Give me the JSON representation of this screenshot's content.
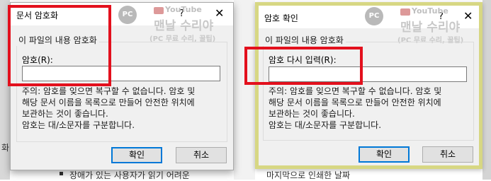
{
  "background": {
    "left_char": "화",
    "bottom_left_text": "장애가 있는 사용자가 읽기 어려운",
    "bottom_right_text": "마지막으로 인쇄한 날짜"
  },
  "watermark": {
    "logo_text": "PC",
    "youtube_label": "YouTube",
    "channel_name": "맨날 수리야",
    "channel_sub": "(PC 무료 수리, 꿀팁)"
  },
  "dialog_encrypt": {
    "title": "문서 암호화",
    "help": "?",
    "close": "✕",
    "group_label": "이 파일의 내용 암호화",
    "password_label": "암호(R):",
    "password_value": "",
    "note_lines": [
      "주의: 암호를 잊으면 복구할 수 없습니다. 암호 및",
      "해당 문서 이름을 목록으로 만들어 안전한 위치에",
      "보관하는 것이 좋습니다.",
      "암호는 대/소문자를 구분합니다."
    ],
    "ok_label": "확인",
    "cancel_label": "취소"
  },
  "dialog_confirm": {
    "title": "암호 확인",
    "help": "?",
    "close": "✕",
    "group_label": "이 파일의 내용 암호화",
    "password_label": "암호 다시 입력(R):",
    "password_value": "",
    "note_lines": [
      "주의: 암호를 잊으면 복구할 수 없습니다. 암호 및",
      "해당 문서 이름을 목록으로 만들어 안전한 위치에",
      "보관하는 것이 좋습니다.",
      "암호는 대/소문자를 구분합니다."
    ],
    "ok_label": "확인",
    "cancel_label": "취소"
  },
  "colors": {
    "highlight_red": "#e3101d",
    "active_border": "#d7d783",
    "default_button_border": "#0078d7"
  }
}
